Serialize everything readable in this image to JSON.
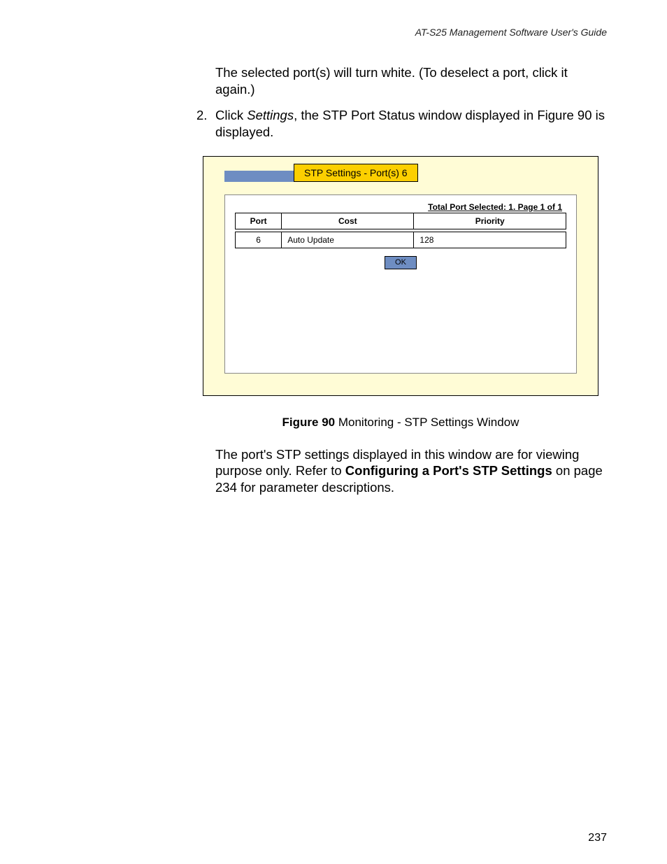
{
  "header": {
    "running": "AT-S25 Management Software User's Guide"
  },
  "para1": "The selected port(s) will turn white. (To deselect a port, click it again.)",
  "step2": {
    "num": "2.",
    "pre": "Click ",
    "settings": "Settings",
    "post": ", the STP Port Status window displayed in Figure 90 is displayed."
  },
  "window": {
    "title": "STP Settings - Port(s) 6",
    "status": "Total Port Selected: 1. Page 1 of 1",
    "columns": {
      "port": "Port",
      "cost": "Cost",
      "priority": "Priority"
    },
    "rows": [
      {
        "port": "6",
        "cost": "Auto Update",
        "priority": "128"
      }
    ],
    "ok": "OK"
  },
  "caption": {
    "bold": "Figure 90",
    "rest": "  Monitoring - STP Settings Window"
  },
  "para_after": {
    "p1": "The port's STP settings displayed in this window are for viewing purpose only. Refer to ",
    "bold": "Configuring a Port's STP Settings",
    "p2": " on page 234 for parameter descriptions."
  },
  "page_number": "237"
}
